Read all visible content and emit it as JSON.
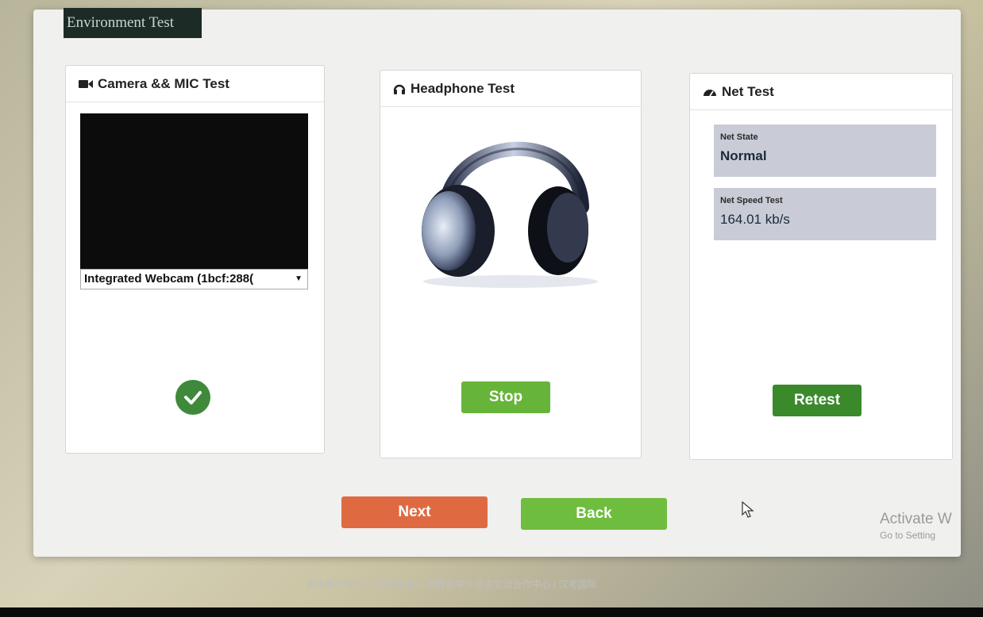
{
  "window": {
    "title": "Environment Test"
  },
  "camera_panel": {
    "title": "Camera && MIC Test",
    "device_selected": "Integrated Webcam (1bcf:288("
  },
  "headphone_panel": {
    "title": "Headphone Test",
    "stop_label": "Stop"
  },
  "net_panel": {
    "title": "Net Test",
    "state_label": "Net State",
    "state_value": "Normal",
    "speed_label": "Net Speed Test",
    "speed_value": "164.01 kb/s",
    "retest_label": "Retest"
  },
  "navigation": {
    "next_label": "Next",
    "back_label": "Back"
  },
  "overlay": {
    "activate_title": "Activate W",
    "activate_sub": "Go to Setting"
  },
  "footer": {
    "text": "网考客户端V3.0 版权所有 © 教育部中外语言交流合作中心 / 汉考国际"
  },
  "colors": {
    "next": "#df6a42",
    "back": "#6fbd3e",
    "stop": "#67b43a",
    "retest": "#3a8a2c",
    "check": "#3e8a3a"
  }
}
